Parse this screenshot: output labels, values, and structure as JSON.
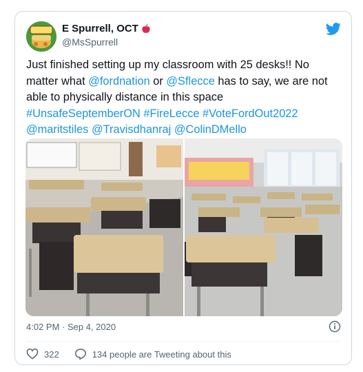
{
  "tweet": {
    "display_name": "E Spurrell, OCT",
    "name_emoji": "apple-icon",
    "handle": "@MsSpurrell",
    "avatar_text": "Freshly Baked",
    "text": {
      "line1": "Just finished setting up my classroom with 25 desks!! No",
      "line2_pre": "matter what ",
      "mention1": "@fordnation",
      "line2_mid": " or ",
      "mention2": "@Sflecce",
      "line2_post": " has to say, we are not",
      "line3": "able to physically distance in this space",
      "hashtag1": "#UnsafeSeptemberON",
      "hashtag2": "#FireLecce",
      "hashtag3": "#VoteFordOut2022",
      "mention3": "@maritstiles",
      "mention4": "@Travisdhanraj",
      "mention5": "@ColinDMello"
    },
    "timestamp": "4:02 PM · Sep 4, 2020",
    "likes": "322",
    "replies_text": "134 people are Tweeting about this",
    "colors": {
      "link": "#1b95e0",
      "twitter_blue": "#1d9bf0",
      "secondary_text": "#536471"
    },
    "icons": [
      "twitter-bird-icon",
      "info-icon",
      "heart-icon",
      "speech-bubble-icon"
    ]
  }
}
